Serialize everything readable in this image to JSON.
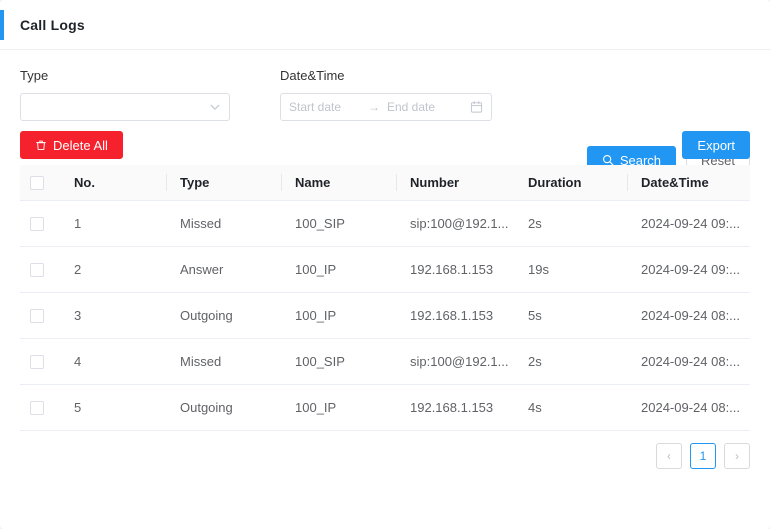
{
  "header": {
    "title": "Call Logs",
    "accent_color": "#2196f3"
  },
  "filters": {
    "type": {
      "label": "Type",
      "value": "",
      "placeholder": "",
      "icon": "chevron-down-icon"
    },
    "date_time": {
      "label": "Date&Time",
      "start_value": "",
      "start_placeholder": "Start date",
      "separator": "→",
      "end_value": "",
      "end_placeholder": "End date",
      "icon": "calendar-icon"
    },
    "search_button": {
      "label": "Search",
      "icon": "search-icon",
      "color": "#2196f3"
    },
    "reset_button": {
      "label": "Reset"
    }
  },
  "toolbar": {
    "delete_all_button": {
      "label": "Delete All",
      "icon": "trash-icon",
      "color": "#f5222d"
    },
    "export_button": {
      "label": "Export",
      "color": "#2196f3"
    }
  },
  "table": {
    "columns": [
      {
        "key": "check",
        "label": ""
      },
      {
        "key": "no",
        "label": "No."
      },
      {
        "key": "type",
        "label": "Type"
      },
      {
        "key": "name",
        "label": "Name"
      },
      {
        "key": "number",
        "label": "Number"
      },
      {
        "key": "duration",
        "label": "Duration"
      },
      {
        "key": "date_time",
        "label": "Date&Time"
      }
    ],
    "rows": [
      {
        "no": "1",
        "type": "Missed",
        "name": "100_SIP",
        "number": "sip:100@192.1...",
        "duration": "2s",
        "date_time": "2024-09-24 09:..."
      },
      {
        "no": "2",
        "type": "Answer",
        "name": "100_IP",
        "number": "192.168.1.153",
        "duration": "19s",
        "date_time": "2024-09-24 09:..."
      },
      {
        "no": "3",
        "type": "Outgoing",
        "name": "100_IP",
        "number": "192.168.1.153",
        "duration": "5s",
        "date_time": "2024-09-24 08:..."
      },
      {
        "no": "4",
        "type": "Missed",
        "name": "100_SIP",
        "number": "sip:100@192.1...",
        "duration": "2s",
        "date_time": "2024-09-24 08:..."
      },
      {
        "no": "5",
        "type": "Outgoing",
        "name": "100_IP",
        "number": "192.168.1.153",
        "duration": "4s",
        "date_time": "2024-09-24 08:..."
      }
    ]
  },
  "pagination": {
    "prev_label": "‹",
    "next_label": "›",
    "current_page": "1"
  }
}
